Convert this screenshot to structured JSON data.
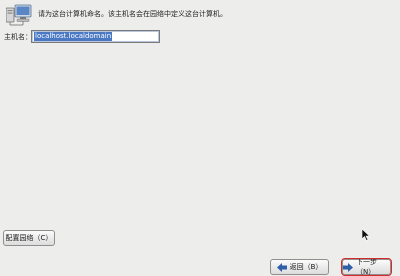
{
  "header": {
    "icon": "computer-network-icon",
    "instruction": "请为这台计算机命名。该主机名会在园络中定义这台计算机。"
  },
  "hostname": {
    "label": "主机名：",
    "value": "localhost.localdomain"
  },
  "buttons": {
    "configure_network": "配置园络（C）",
    "back": "返回（B）",
    "next": "下一步（N）"
  },
  "colors": {
    "background": "#ededec",
    "selection": "#4a78c2",
    "highlight_border": "#d42a2a",
    "arrow": "#2f5fa8"
  }
}
